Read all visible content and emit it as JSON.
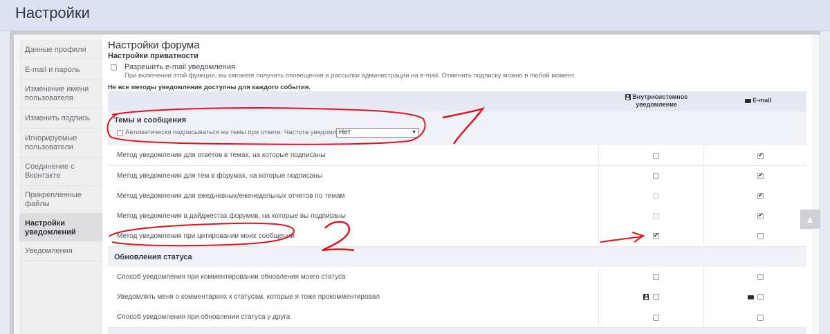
{
  "header": {
    "title": "Настройки"
  },
  "sidebar": {
    "items": [
      {
        "label": "Данные профиля"
      },
      {
        "label": "E-mail и пароль"
      },
      {
        "label": "Изменение имени пользователя"
      },
      {
        "label": "Изменить подпись"
      },
      {
        "label": "Игнорируемые пользователи"
      },
      {
        "label": "Соединение с Вконтакте"
      },
      {
        "label": "Прикрепленные файлы"
      },
      {
        "label": "Настройки уведомлений"
      },
      {
        "label": "Уведомления"
      }
    ]
  },
  "main": {
    "title": "Настройки форума",
    "privacy_heading": "Настройки приватности",
    "email_allow": {
      "label": "Разрешить e-mail уведомления",
      "description": "При включении этой функции, вы сможете получать оповещения и рассылки администрации на e-mail. Отменить подписку можно в любой момент.",
      "checked": false
    },
    "note": "Не все методы уведомления доступны для каждого события.",
    "columns": {
      "internal": "Внутрисистемное уведомление",
      "email": "E-mail"
    },
    "sections": [
      {
        "title": "Темы и сообщения",
        "auto_subscribe": {
          "label": "Автоматически подписываться на темы при ответе. Частота уведомлений:",
          "select_value": "Нет",
          "checked": false
        },
        "rows": [
          {
            "label": "Метод уведомления для ответов в темах, на которые подписаны",
            "internal": "unchecked",
            "email": "checked"
          },
          {
            "label": "Метод уведомления для тем в форумах, на которые подписаны",
            "internal": "unchecked",
            "email": "checked"
          },
          {
            "label": "Метод уведомления для ежедневных/еженедельных отчетов по темам",
            "internal": "disabled",
            "email": "checked"
          },
          {
            "label": "Метод уведомления в дайджестах форумов, на которые вы подписаны",
            "internal": "disabled",
            "email": "checked"
          },
          {
            "label": "Метод уведомления при цитировании моих сообщений",
            "internal": "checked",
            "email": "unchecked"
          }
        ]
      },
      {
        "title": "Обновления статуса",
        "rows": [
          {
            "label": "Способ уведомления при комментировании обновления моего статуса",
            "internal": "unchecked",
            "email": "unchecked"
          },
          {
            "label": "Уведомлять меня о комментариях к статусам, которые я тоже прокомментировал",
            "internal": "unchecked",
            "email": "unchecked",
            "with_icons": true
          },
          {
            "label": "Способ уведомления при обновлении статуса у друга",
            "internal": "unchecked",
            "email": "unchecked"
          }
        ]
      }
    ]
  },
  "annotations": {
    "mark1": "7",
    "mark2": "2",
    "color": "#e0121b"
  },
  "colors": {
    "accent_bg": "#dde2f1",
    "header_row": "#e6e9f3",
    "section_bg": "#f1f2f7"
  }
}
